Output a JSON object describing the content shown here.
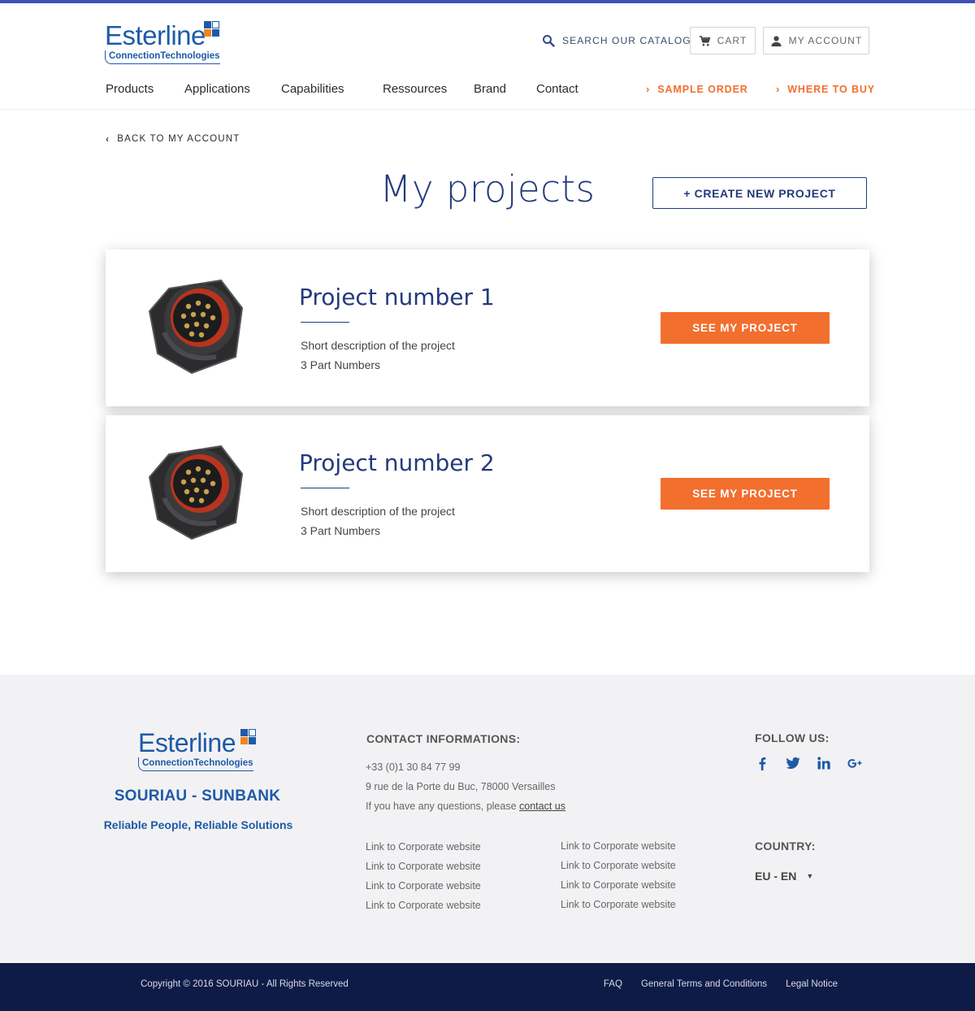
{
  "brand": {
    "logo_word": "Esterline",
    "logo_sub": "ConnectionTechnologies",
    "colors": {
      "primary": "#243a7c",
      "accent": "#f26f2e",
      "logo_blue": "#1e5aa8",
      "logo_orange": "#f58220",
      "footer_bg": "#f2f2f4",
      "bottom_bar": "#0e1b47"
    }
  },
  "header": {
    "search_label": "SEARCH OUR CATALOG",
    "search_icon": "search-icon",
    "cart_label": "CART",
    "cart_icon": "cart-icon",
    "account_label": "MY ACCOUNT",
    "account_icon": "user-icon",
    "nav": [
      "Products",
      "Applications",
      "Capabilities",
      "Ressources",
      "Brand",
      "Contact"
    ],
    "sample_order": "SAMPLE ORDER",
    "where_to_buy": "WHERE TO BUY"
  },
  "page": {
    "back_label": "BACK TO MY ACCOUNT",
    "title": "My projects",
    "create_label": "+ CREATE NEW PROJECT"
  },
  "projects": [
    {
      "title": "Project number 1",
      "description": "Short description of the project",
      "parts": "3 Part Numbers",
      "button": "SEE MY PROJECT",
      "image_icon": "connector-image"
    },
    {
      "title": "Project number 2",
      "description": "Short description of the project",
      "parts": "3 Part Numbers",
      "button": "SEE MY PROJECT",
      "image_icon": "connector-image"
    }
  ],
  "footer": {
    "company": "SOURIAU - SUNBANK",
    "tagline": "Reliable People, Reliable Solutions",
    "contact_heading": "CONTACT INFORMATIONS:",
    "phone": "+33 (0)1 30 84 77 99",
    "address": "9 rue de la Porte du Buc, 78000 Versailles",
    "question_prefix": "If you have any questions, please ",
    "contact_us": "contact us",
    "links_col1": [
      "Link to Corporate website",
      "Link to Corporate website",
      "Link to Corporate website",
      "Link to Corporate website"
    ],
    "links_col2": [
      "Link to Corporate website",
      "Link to Corporate website",
      "Link to Corporate website",
      "Link to Corporate website"
    ],
    "follow_heading": "FOLLOW US:",
    "social": [
      "facebook-icon",
      "twitter-icon",
      "linkedin-icon",
      "google-plus-icon"
    ],
    "country_heading": "COUNTRY:",
    "country_value": "EU - EN"
  },
  "bottom": {
    "copyright": "Copyright © 2016 SOURIAU - All Rights Reserved",
    "links": [
      "FAQ",
      "General Terms and Conditions",
      "Legal Notice"
    ]
  }
}
